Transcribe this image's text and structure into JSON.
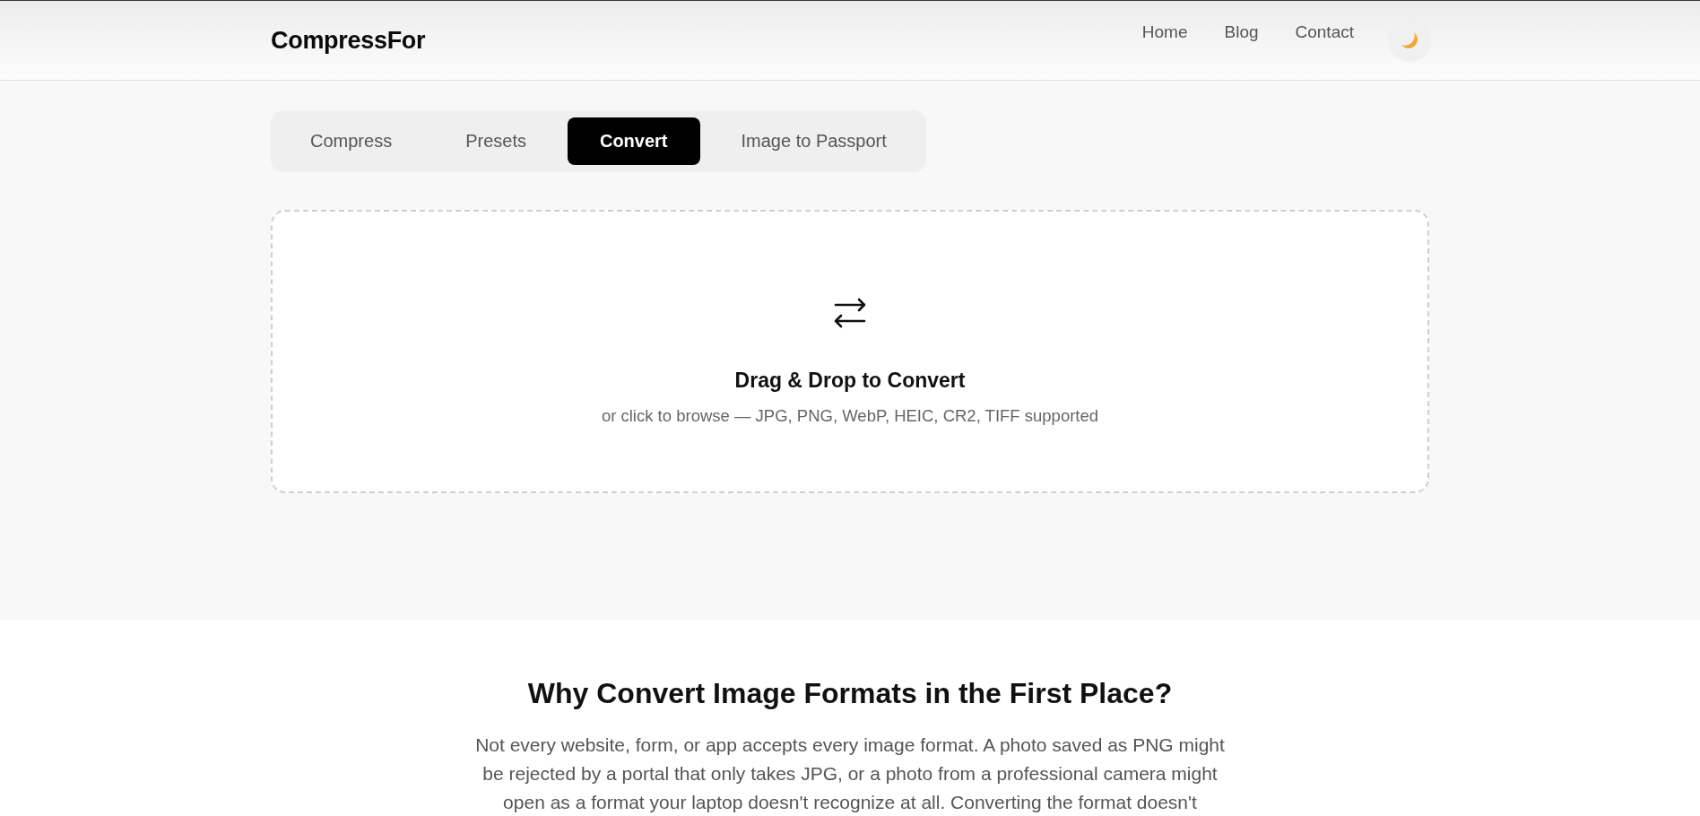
{
  "header": {
    "logo": "CompressFor",
    "nav": [
      "Home",
      "Blog",
      "Contact"
    ]
  },
  "tabs": [
    {
      "label": "Compress",
      "selected": false
    },
    {
      "label": "Presets",
      "selected": false
    },
    {
      "label": "Convert",
      "selected": true
    },
    {
      "label": "Image to Passport",
      "selected": false
    }
  ],
  "dropzone": {
    "title": "Drag & Drop to Convert",
    "subtitle": "or click to browse — JPG, PNG, WebP, HEIC, CR2, TIFF supported"
  },
  "article": {
    "heading": "Why Convert Image Formats in the First Place?",
    "paragraph": "Not every website, form, or app accepts every image format. A photo saved as PNG might be rejected by a portal that only takes JPG, or a photo from a professional camera might open as a format your laptop doesn't recognize at all. Converting the format doesn't"
  }
}
